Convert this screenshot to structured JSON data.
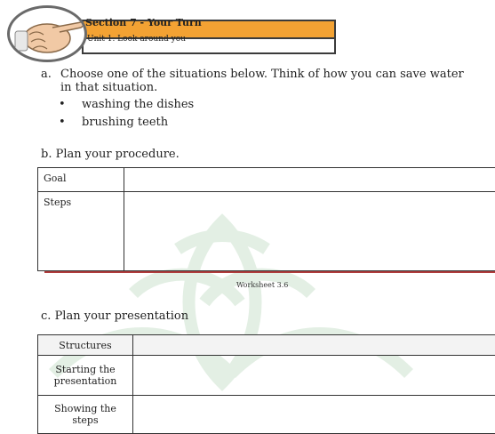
{
  "header": {
    "section_title": "Section 7 - Your Turn",
    "unit": "Unit 1. Look around you"
  },
  "part_a": {
    "marker": "a.",
    "prompt": "Choose one of the situations below. Think of how you can save water in that situation.",
    "bullets": [
      "washing the dishes",
      "brushing teeth"
    ]
  },
  "part_b": {
    "marker": "b.",
    "title": "Plan your procedure.",
    "rows": [
      {
        "label": "Goal",
        "value": ""
      },
      {
        "label": "Steps",
        "value": ""
      }
    ],
    "worksheet": "Worksheet 3.6"
  },
  "part_c": {
    "marker": "c.",
    "title": "Plan your presentation",
    "rows": [
      {
        "label": "Structures",
        "value": ""
      },
      {
        "label": "Starting the presentation",
        "value": ""
      },
      {
        "label": "Showing the steps",
        "value": ""
      }
    ]
  },
  "colors": {
    "section_bar": "#f3a233",
    "rule": "#b03c3c",
    "watermark": "#e9f3ea"
  }
}
